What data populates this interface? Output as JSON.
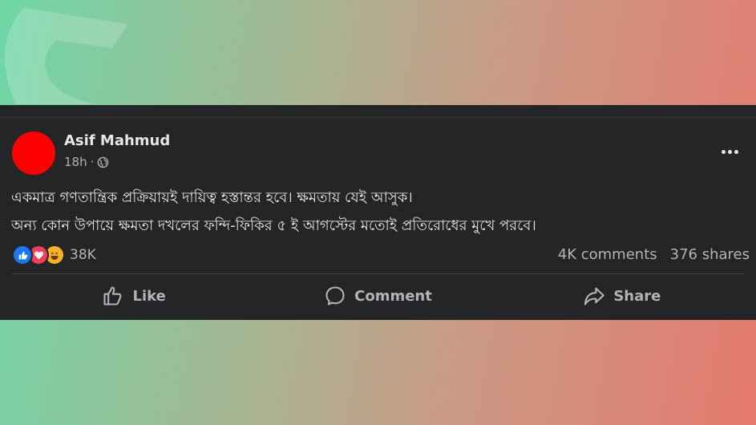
{
  "post": {
    "author": "Asif Mahmud",
    "time": "18h",
    "separator": "·",
    "body": {
      "line1": "একমাত্র গণতান্ত্রিক প্রক্রিয়ায়ই দায়িত্ব হস্তান্তর হবে। ক্ষমতায় যেই আসুক।",
      "line2": "অন্য কোন উপায়ে ক্ষমতা দখলের ফন্দি-ফিকির ৫ ই আগস্টের মতোই প্রতিরোধের মুখে পরবে।"
    },
    "reactions": {
      "icons": [
        "like-icon",
        "love-icon",
        "haha-icon"
      ],
      "count": "38K"
    },
    "comments": "4K comments",
    "shares": "376 shares",
    "actions": {
      "like": "Like",
      "comment": "Comment",
      "share": "Share"
    }
  },
  "colors": {
    "avatar": "#ff0000",
    "card": "#242526",
    "text": "#e4e6eb",
    "secondary_text": "#b0b3b8",
    "like_blue": "#1877f2",
    "love_red": "#f33e58",
    "haha_yellow": "#f7b125"
  }
}
